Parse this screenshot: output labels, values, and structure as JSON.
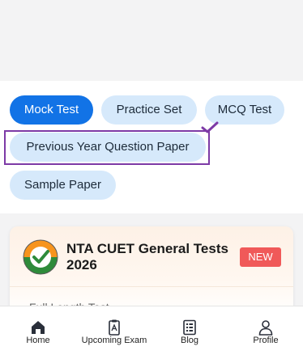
{
  "filters": {
    "chips": [
      {
        "label": "Mock Test",
        "active": true
      },
      {
        "label": "Practice Set",
        "active": false
      },
      {
        "label": "MCQ Test",
        "active": false
      },
      {
        "label": "Previous Year Question Paper",
        "active": false
      },
      {
        "label": "Sample Paper",
        "active": false
      }
    ]
  },
  "card": {
    "logo": "nta-emblem-icon",
    "title": "NTA CUET General Tests 2026",
    "badge": "NEW",
    "subtitle": "Full Length Test"
  },
  "bottom_nav": {
    "items": [
      {
        "label": "Home",
        "icon": "home-icon"
      },
      {
        "label": "Upcoming Exam",
        "icon": "exam-icon"
      },
      {
        "label": "Blog",
        "icon": "blog-icon"
      },
      {
        "label": "Profile",
        "icon": "profile-icon"
      }
    ]
  },
  "colors": {
    "accent": "#1273e6",
    "chip_bg": "#d6e9fb",
    "highlight": "#7d3aa6",
    "badge": "#f05959"
  }
}
